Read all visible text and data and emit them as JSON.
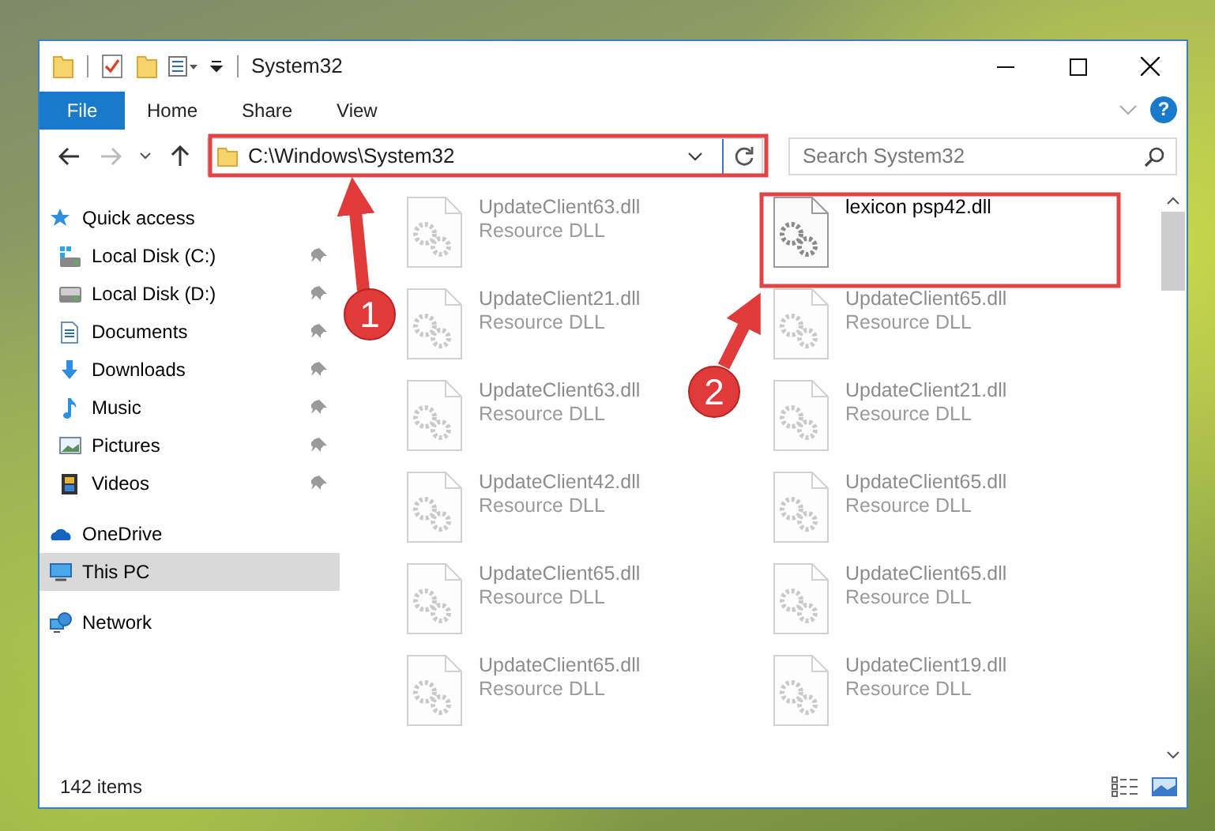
{
  "window": {
    "title": "System32"
  },
  "ribbon_tabs": [
    {
      "label": "File",
      "kind": "file"
    },
    {
      "label": "Home",
      "kind": "tab"
    },
    {
      "label": "Share",
      "kind": "tab"
    },
    {
      "label": "View",
      "kind": "tab"
    }
  ],
  "help_button": {
    "label": "?"
  },
  "address_bar": {
    "path": "C:\\Windows\\System32"
  },
  "search": {
    "placeholder": "Search System32"
  },
  "nav_pane": [
    {
      "label": "Quick access",
      "kind": "star",
      "selected": false,
      "children": [
        {
          "label": "Local Disk (C:)",
          "kind": "system-drive",
          "pinned": true,
          "selected": false
        },
        {
          "label": "Local Disk (D:)",
          "kind": "drive",
          "pinned": true,
          "selected": false
        },
        {
          "label": "Documents",
          "kind": "documents",
          "pinned": true,
          "selected": false
        },
        {
          "label": "Downloads",
          "kind": "downloads",
          "pinned": true,
          "selected": false
        },
        {
          "label": "Music",
          "kind": "music",
          "pinned": true,
          "selected": false
        },
        {
          "label": "Pictures",
          "kind": "pictures",
          "pinned": true,
          "selected": false
        },
        {
          "label": "Videos",
          "kind": "videos",
          "pinned": true,
          "selected": false
        }
      ]
    },
    {
      "label": "OneDrive",
      "kind": "cloud",
      "selected": false
    },
    {
      "label": "This PC",
      "kind": "pc",
      "selected": true
    },
    {
      "label": "Network",
      "kind": "network",
      "selected": false
    }
  ],
  "files": [
    {
      "name": "UpdateClient63.dll",
      "type": "Resource DLL",
      "dimmed": true
    },
    {
      "name": "lexicon psp42.dll",
      "dimmed": false
    },
    {
      "name": "UpdateClient21.dll",
      "type": "Resource DLL",
      "dimmed": true
    },
    {
      "name": "UpdateClient65.dll",
      "type": "Resource DLL",
      "dimmed": true
    },
    {
      "name": "UpdateClient63.dll",
      "type": "Resource DLL",
      "dimmed": true
    },
    {
      "name": "UpdateClient21.dll",
      "type": "Resource DLL",
      "dimmed": true
    },
    {
      "name": "UpdateClient42.dll",
      "type": "Resource DLL",
      "dimmed": true
    },
    {
      "name": "UpdateClient65.dll",
      "type": "Resource DLL",
      "dimmed": true
    },
    {
      "name": "UpdateClient65.dll",
      "type": "Resource DLL",
      "dimmed": true
    },
    {
      "name": "UpdateClient65.dll",
      "type": "Resource DLL",
      "dimmed": true
    },
    {
      "name": "UpdateClient65.dll",
      "type": "Resource DLL",
      "dimmed": true
    },
    {
      "name": "UpdateClient19.dll",
      "type": "Resource DLL",
      "dimmed": true
    }
  ],
  "annotations": [
    {
      "number": "1"
    },
    {
      "number": "2"
    }
  ],
  "status_bar": {
    "item_count": "142 items"
  }
}
